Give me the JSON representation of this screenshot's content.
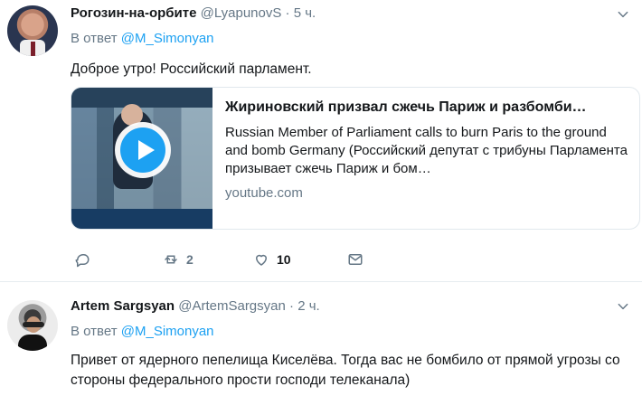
{
  "tweets": [
    {
      "display_name": "Рогозин-на-орбите",
      "handle": "@LyapunovS",
      "dot": "·",
      "time": "5 ч.",
      "reply_prefix": "В ответ",
      "reply_to": "@M_Simonyan",
      "text": "Доброе утро! Российский парламент.",
      "card": {
        "title": "Жириновский призвал сжечь Париж и разбомби…",
        "description": "Russian Member of Parliament calls to burn Paris to the ground and bomb Germany (Российский депутат с трибуны Парламента призывает сжечь Париж и бом…",
        "domain": "youtube.com"
      },
      "actions": {
        "reply_count": "",
        "retweet_count": "2",
        "like_count": "10"
      }
    },
    {
      "display_name": "Artem Sargsyan",
      "handle": "@ArtemSargsyan",
      "dot": "·",
      "time": "2 ч.",
      "reply_prefix": "В ответ",
      "reply_to": "@M_Simonyan",
      "text": "Привет от ядерного пепелища Киселёва. Тогда вас не бомбило от прямой угрозы со стороны федерального прости господи телеканала)"
    }
  ],
  "icons": {
    "more": "chevron-down-icon",
    "reply": "reply-icon",
    "retweet": "retweet-icon",
    "like": "heart-icon",
    "message": "message-icon",
    "play": "play-icon"
  },
  "colors": {
    "accent": "#1da1f2",
    "muted": "#657786",
    "text": "#14171a"
  }
}
